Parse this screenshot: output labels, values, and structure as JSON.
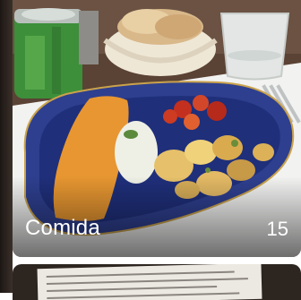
{
  "album": {
    "title": "Comida",
    "count": "15"
  }
}
